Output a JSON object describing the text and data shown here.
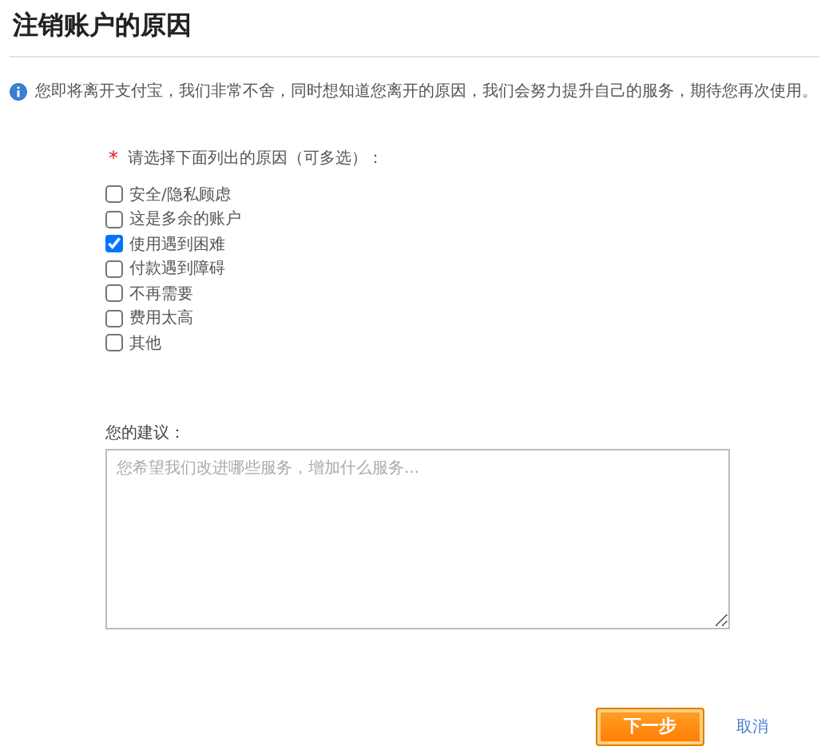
{
  "title": "注销账户的原因",
  "notice": "您即将离开支付宝，我们非常不舍，同时想知道您离开的原因，我们会努力提升自己的服务，期待您再次使用。",
  "reasons_prompt": {
    "required_mark": "*",
    "label": "请选择下面列出的原因（可多选）："
  },
  "reasons": [
    {
      "label": "安全/隐私顾虑",
      "checked": false
    },
    {
      "label": "这是多余的账户",
      "checked": false
    },
    {
      "label": "使用遇到困难",
      "checked": true
    },
    {
      "label": "付款遇到障碍",
      "checked": false
    },
    {
      "label": "不再需要",
      "checked": false
    },
    {
      "label": "费用太高",
      "checked": false
    },
    {
      "label": "其他",
      "checked": false
    }
  ],
  "suggestion": {
    "label": "您的建议：",
    "placeholder": "您希望我们改进哪些服务，增加什么服务..."
  },
  "buttons": {
    "next": "下一步",
    "cancel": "取消"
  }
}
